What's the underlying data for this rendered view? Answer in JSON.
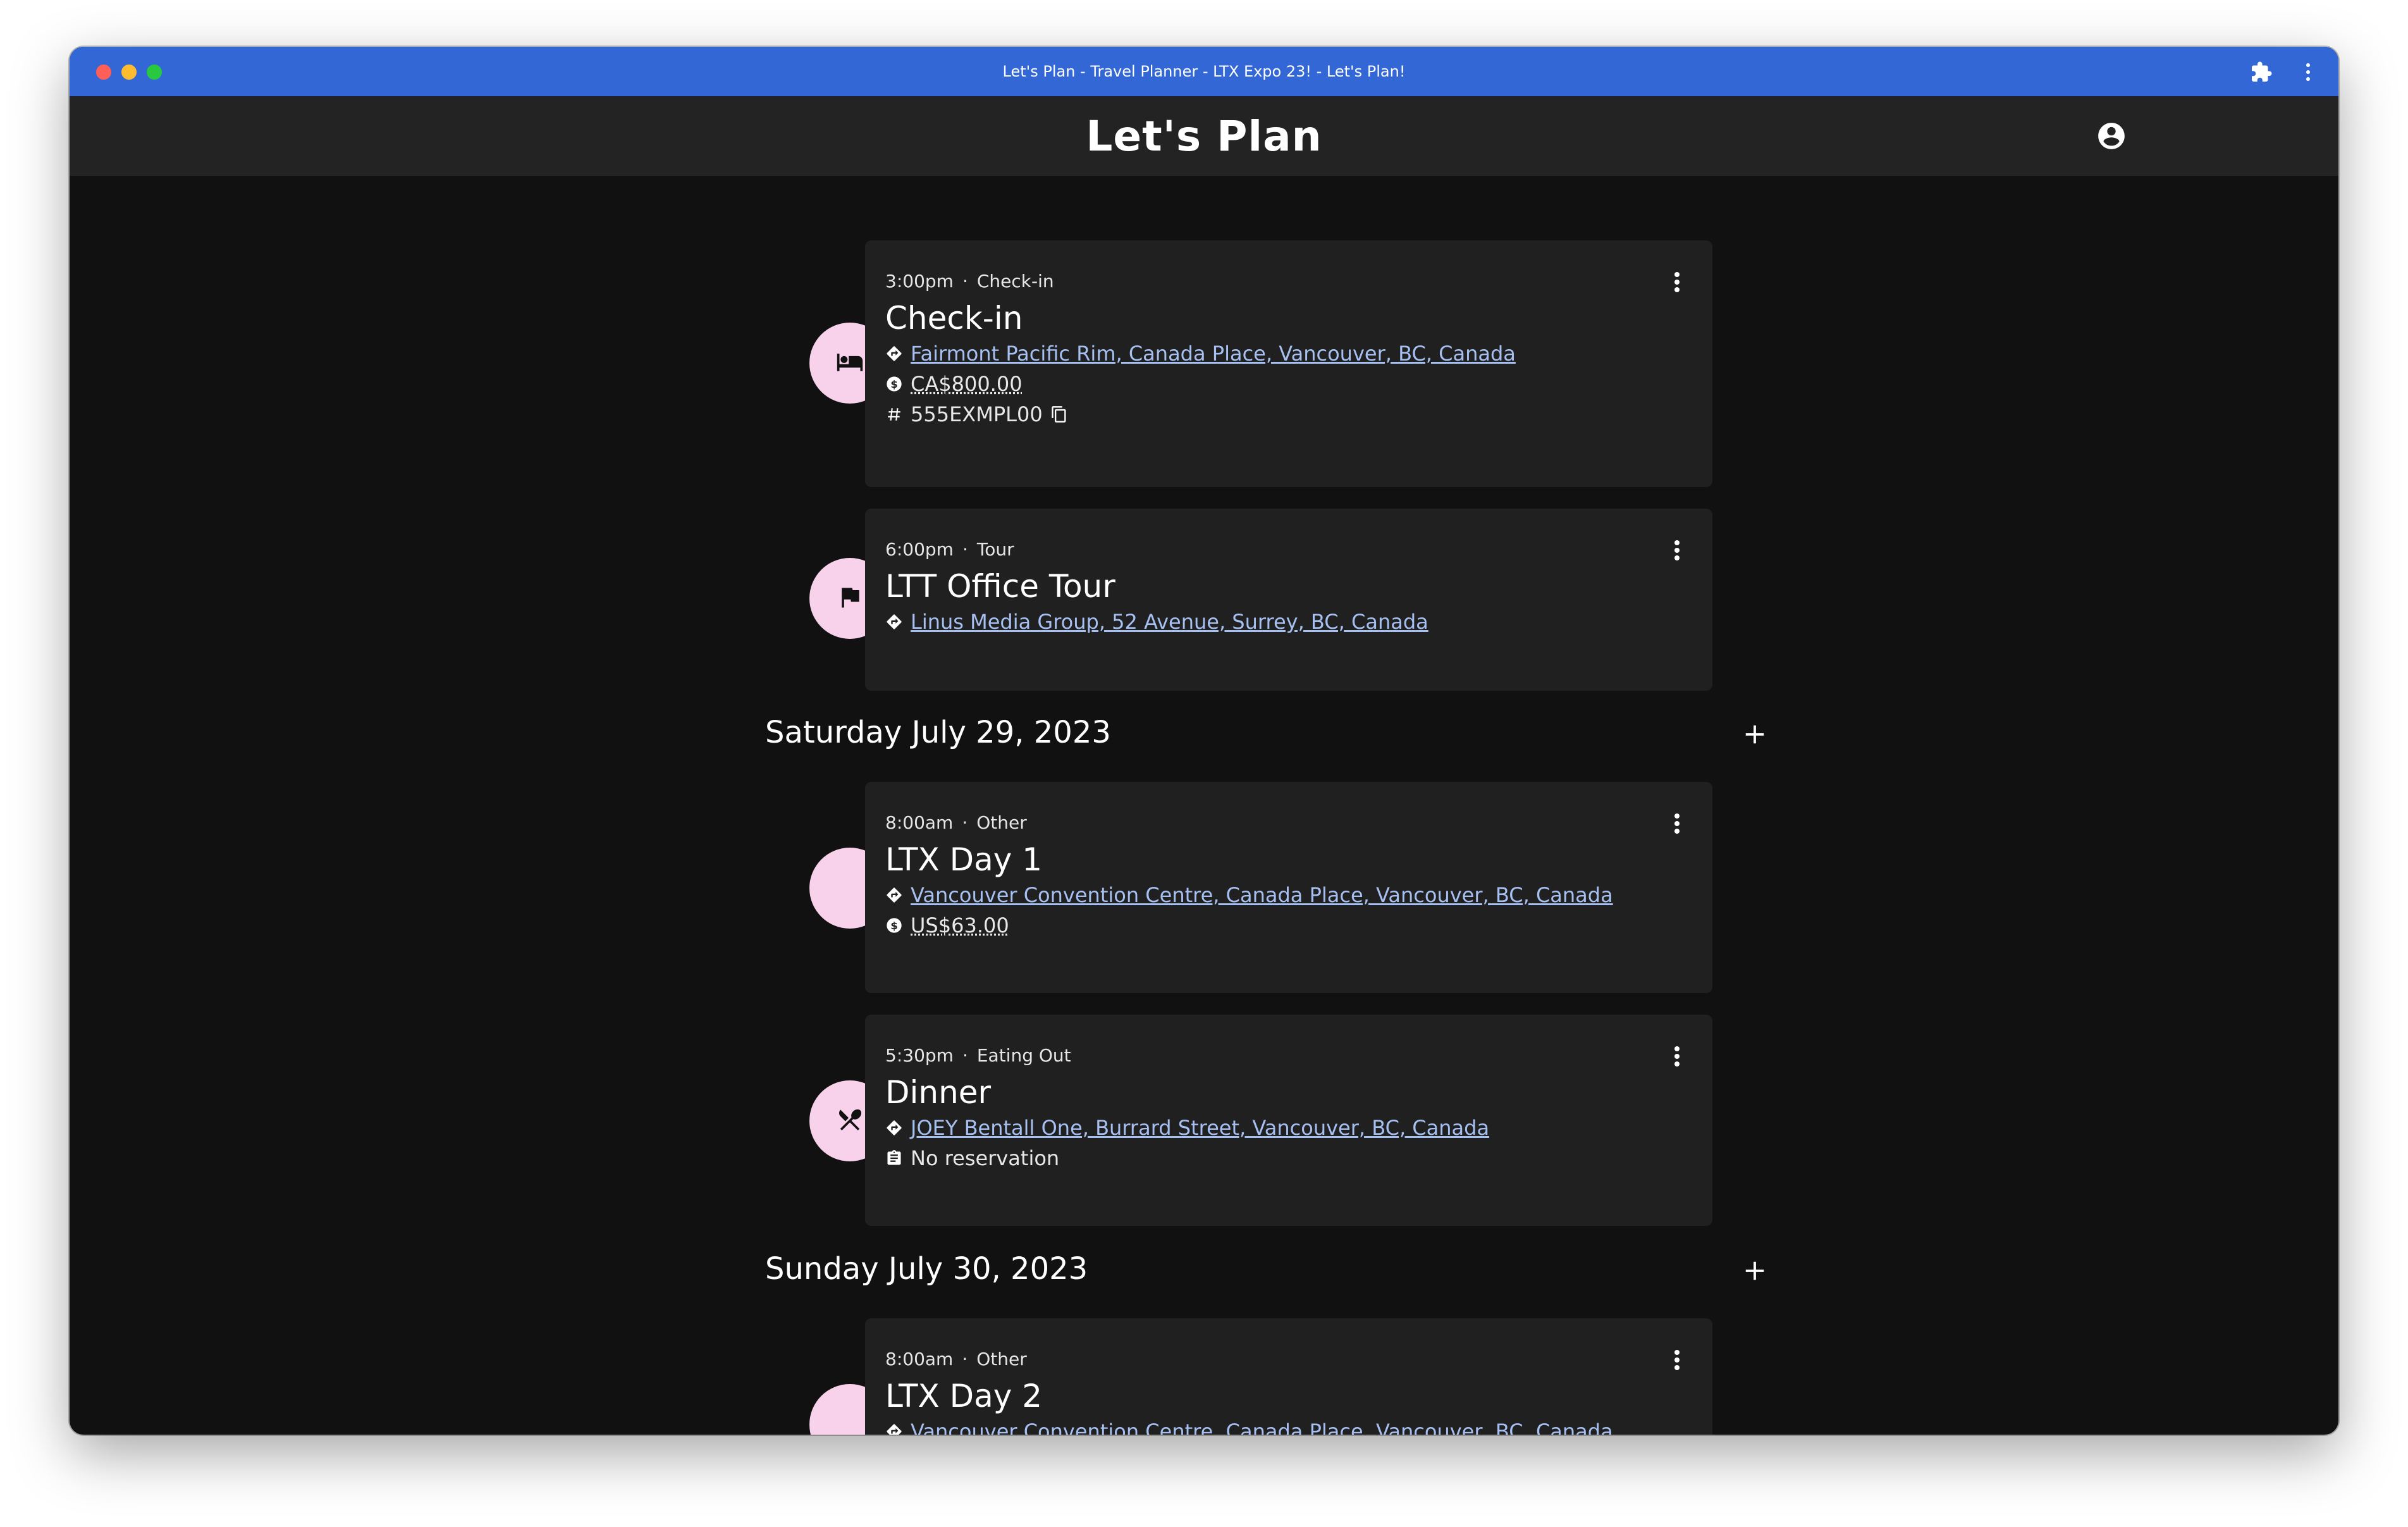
{
  "window": {
    "title": "Let's Plan - Travel Planner - LTX Expo 23! - Let's Plan!"
  },
  "app": {
    "title": "Let's Plan"
  },
  "days": [
    {
      "label": "Saturday July 29, 2023"
    },
    {
      "label": "Sunday July 30, 2023"
    }
  ],
  "events": [
    {
      "time": "3:00pm",
      "category": "Check-in",
      "title": "Check-in",
      "location": "Fairmont Pacific Rim, Canada Place, Vancouver, BC, Canada",
      "cost": "CA$800.00",
      "confirmation": "555EXMPL00",
      "icon": "bed-icon"
    },
    {
      "time": "6:00pm",
      "category": "Tour",
      "title": "LTT Office Tour",
      "location": "Linus Media Group, 52 Avenue, Surrey, BC, Canada",
      "icon": "flag-icon"
    },
    {
      "time": "8:00am",
      "category": "Other",
      "title": "LTX Day 1",
      "location": "Vancouver Convention Centre, Canada Place, Vancouver, BC, Canada",
      "cost": "US$63.00"
    },
    {
      "time": "5:30pm",
      "category": "Eating Out",
      "title": "Dinner",
      "location": "JOEY Bentall One, Burrard Street, Vancouver, BC, Canada",
      "reservation": "No reservation",
      "icon": "utensils-icon"
    },
    {
      "time": "8:00am",
      "category": "Other",
      "title": "LTX Day 2",
      "location": "Vancouver Convention Centre, Canada Place, Vancouver, BC, Canada"
    }
  ],
  "colors": {
    "titlebar": "#3367d6",
    "appbar": "#232323",
    "background": "#111111",
    "card": "#202020",
    "avatar": "#f8d1ea",
    "link": "#a7c0f2"
  }
}
